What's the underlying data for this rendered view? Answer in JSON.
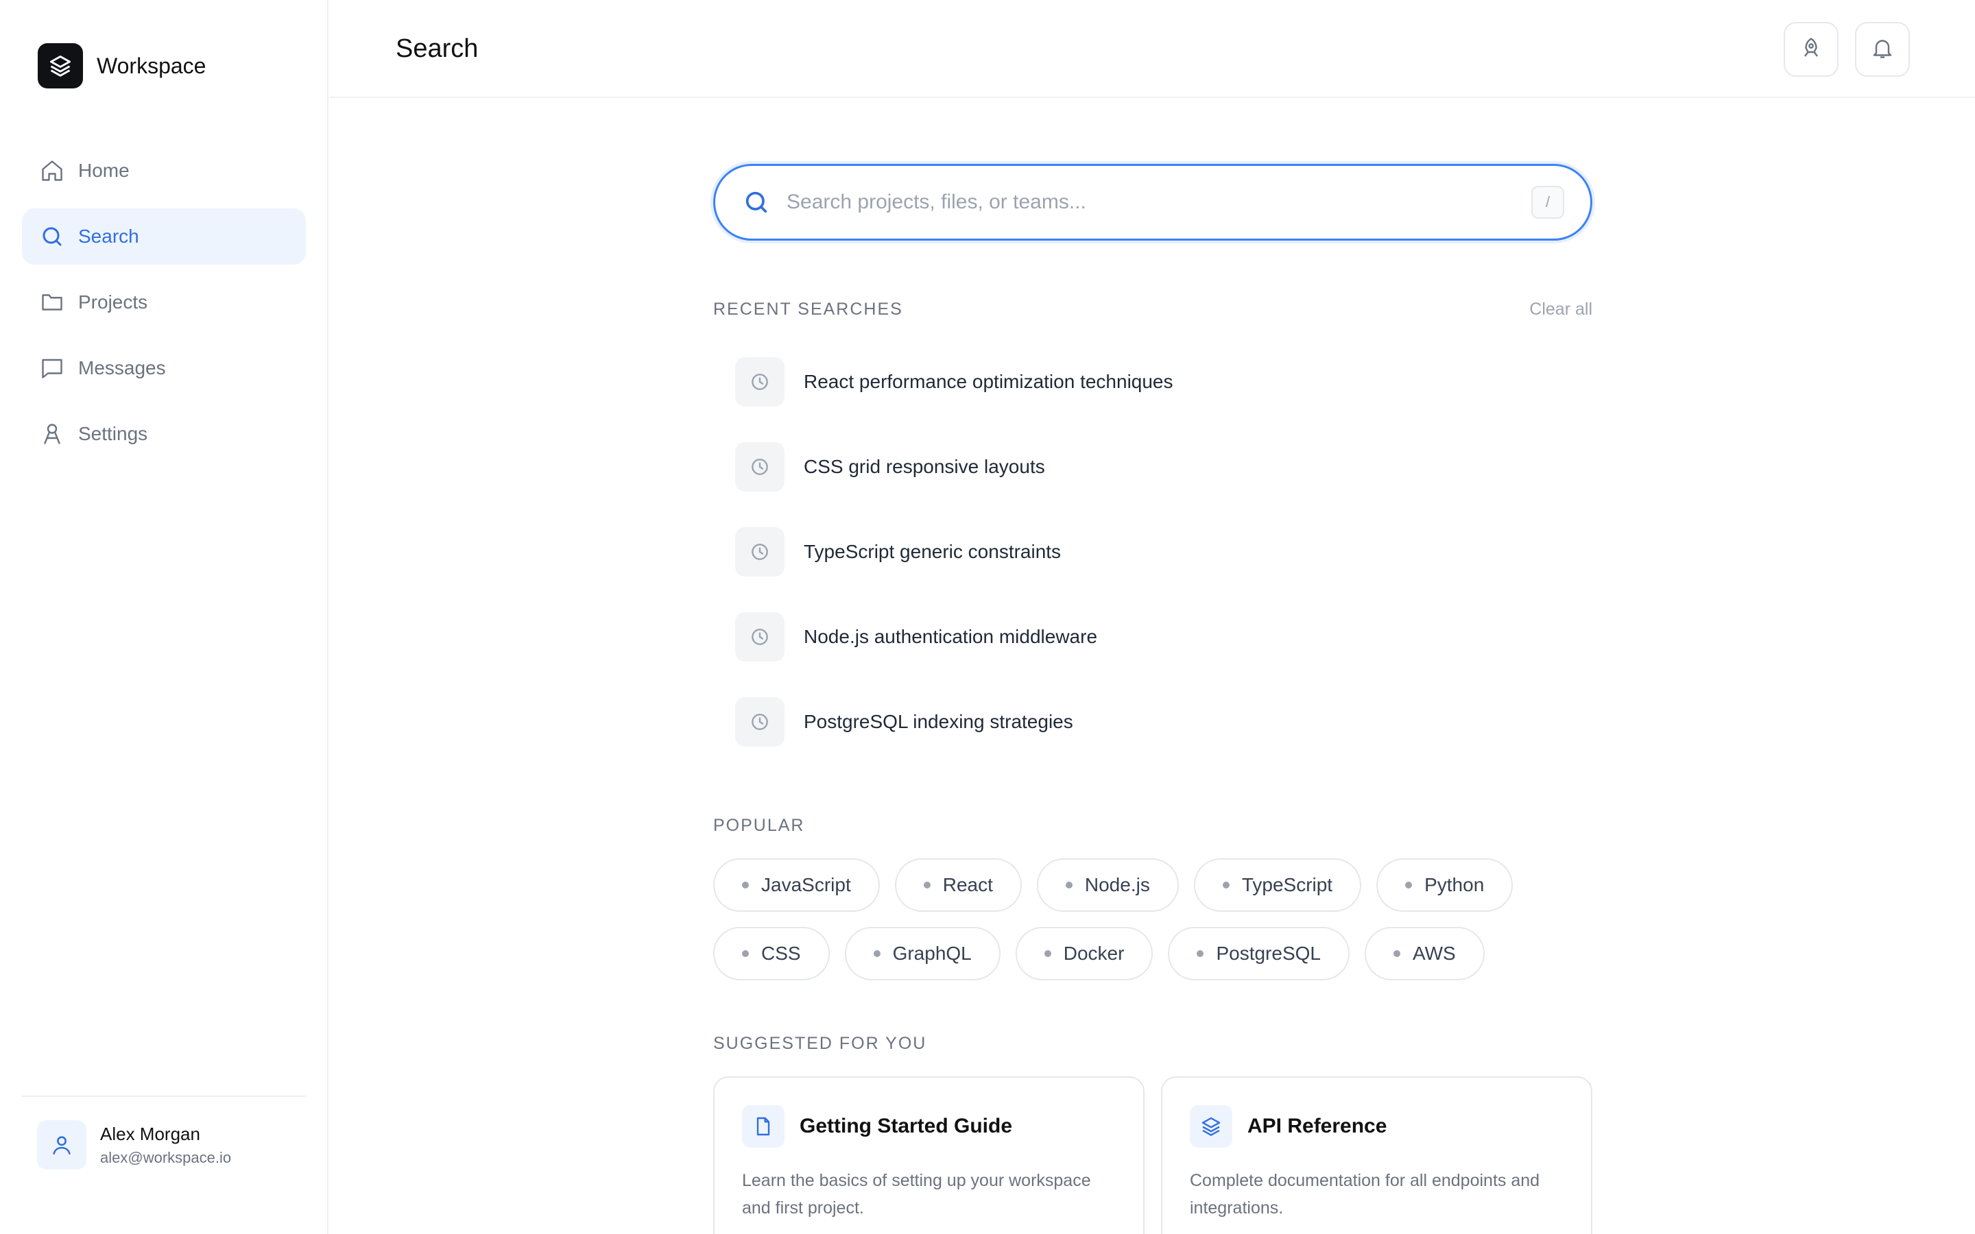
{
  "brand": {
    "name": "Workspace"
  },
  "nav": [
    {
      "label": "Home",
      "icon": "home-icon"
    },
    {
      "label": "Search",
      "icon": "search-icon"
    },
    {
      "label": "Projects",
      "icon": "folder-icon"
    },
    {
      "label": "Messages",
      "icon": "message-icon"
    },
    {
      "label": "Settings",
      "icon": "settings-icon"
    }
  ],
  "active_nav": "Search",
  "user": {
    "name": "Alex Morgan",
    "email": "alex@workspace.io"
  },
  "header": {
    "title": "Search"
  },
  "search": {
    "placeholder": "Search projects, files, or teams...",
    "value": "",
    "shortcut": "/"
  },
  "recent": {
    "label": "RECENT SEARCHES",
    "clear_label": "Clear all",
    "items": [
      "React performance optimization techniques",
      "CSS grid responsive layouts",
      "TypeScript generic constraints",
      "Node.js authentication middleware",
      "PostgreSQL indexing strategies"
    ]
  },
  "popular": {
    "label": "POPULAR",
    "tags_row1": [
      "JavaScript",
      "React",
      "Node.js",
      "TypeScript",
      "Python"
    ],
    "tags_row2": [
      "CSS",
      "GraphQL",
      "Docker",
      "PostgreSQL",
      "AWS"
    ]
  },
  "suggested": {
    "label": "SUGGESTED FOR YOU",
    "cards": [
      {
        "title": "Getting Started Guide",
        "desc": "Learn the basics of setting up your workspace and first project.",
        "icon": "document-icon"
      },
      {
        "title": "API Reference",
        "desc": "Complete documentation for all endpoints and integrations.",
        "icon": "layers-icon"
      }
    ]
  },
  "colors": {
    "accent": "#2f6fde",
    "accent_bg": "#eef4fd",
    "border": "#e5e7eb",
    "muted": "#6b7280"
  }
}
